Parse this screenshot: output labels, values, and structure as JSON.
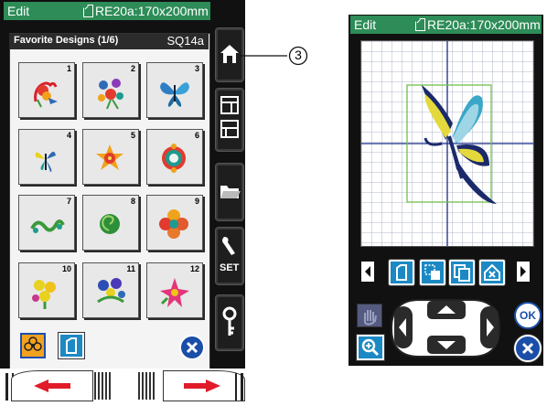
{
  "callout_number": "3",
  "left_screen": {
    "title_bar": {
      "mode": "Edit",
      "hoop": "RE20a:170x200mm"
    },
    "panel_title": "Favorite Designs (1/6)",
    "design_code": "SQ14a",
    "designs": [
      {
        "number": "1",
        "icon": "rooster-design"
      },
      {
        "number": "2",
        "icon": "flower-bouquet-design"
      },
      {
        "number": "3",
        "icon": "butterfly-design"
      },
      {
        "number": "4",
        "icon": "small-butterfly-design"
      },
      {
        "number": "5",
        "icon": "flower-star-design"
      },
      {
        "number": "6",
        "icon": "flower-ring-design"
      },
      {
        "number": "7",
        "icon": "scroll-vine-design"
      },
      {
        "number": "8",
        "icon": "green-spiral-design"
      },
      {
        "number": "9",
        "icon": "four-petal-flower-design"
      },
      {
        "number": "10",
        "icon": "yellow-flower-bunch-design"
      },
      {
        "number": "11",
        "icon": "pansy-design"
      },
      {
        "number": "12",
        "icon": "lily-design"
      }
    ],
    "side_buttons": [
      "home-icon",
      "sewing-machine-icon",
      "folder-icon",
      "set-wrench-icon",
      "key-icon"
    ],
    "side_set_label": "SET",
    "bottom_icons": [
      "favorite-flower-icon",
      "hoop-icon",
      "close-icon"
    ],
    "slider_arrows": [
      "left-arrow",
      "right-arrow"
    ]
  },
  "right_screen": {
    "title_bar": {
      "mode": "Edit",
      "hoop": "RE20a:170x200mm"
    },
    "toolbar_icons": [
      "hoop-select-icon",
      "move-resize-icon",
      "copy-icon",
      "delete-icon"
    ],
    "ok_label": "OK",
    "nav_icons": [
      "up-arrow",
      "down-arrow",
      "left-arrow",
      "right-arrow"
    ]
  },
  "colors": {
    "title_green": "#2d8c57",
    "toolbar_blue": "#1c89c4",
    "arrow_red": "#e01b2a",
    "button_frame": "#111111"
  }
}
